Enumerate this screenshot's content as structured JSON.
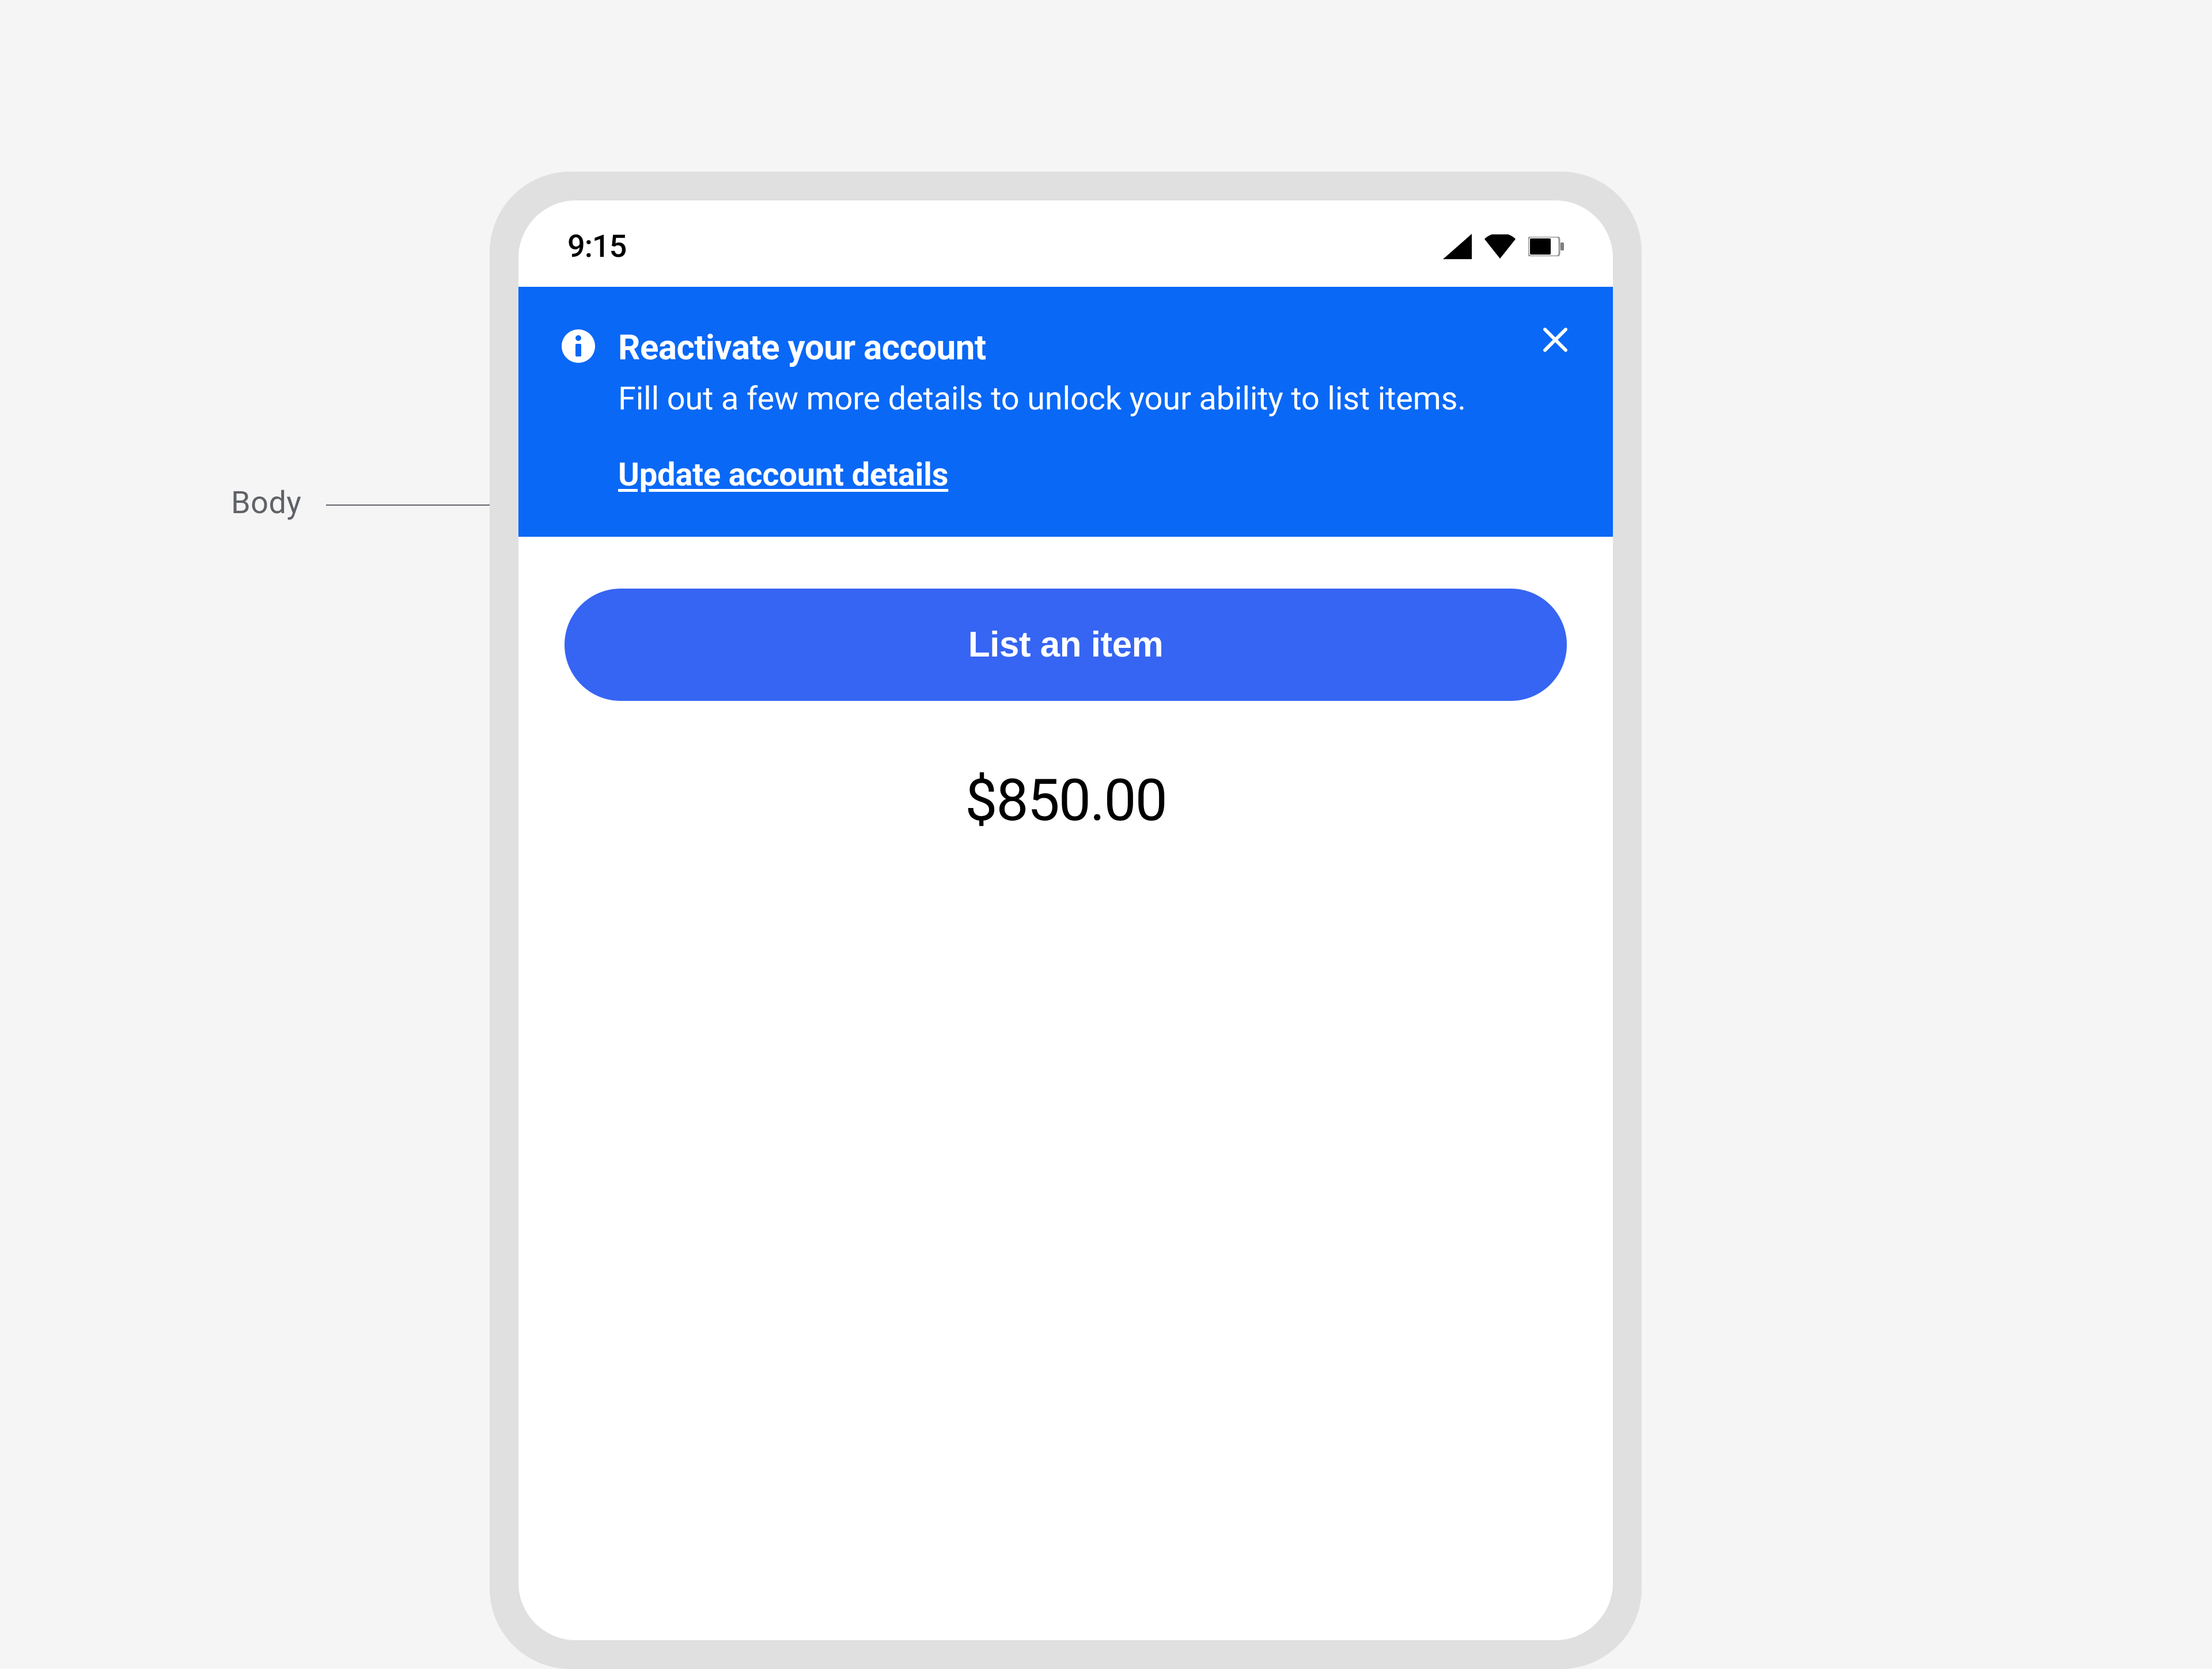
{
  "annotation": {
    "label": "Body"
  },
  "status_bar": {
    "time": "9:15"
  },
  "notice": {
    "title": "Reactivate your account",
    "body": "Fill out a few more details to unlock your ability to list items.",
    "link_label": "Update account details"
  },
  "actions": {
    "list_button_label": "List an item"
  },
  "balance": {
    "amount": "$850.00"
  },
  "colors": {
    "banner_bg": "#0968f6",
    "button_bg": "#3665f3",
    "page_bg": "#f5f5f5"
  }
}
